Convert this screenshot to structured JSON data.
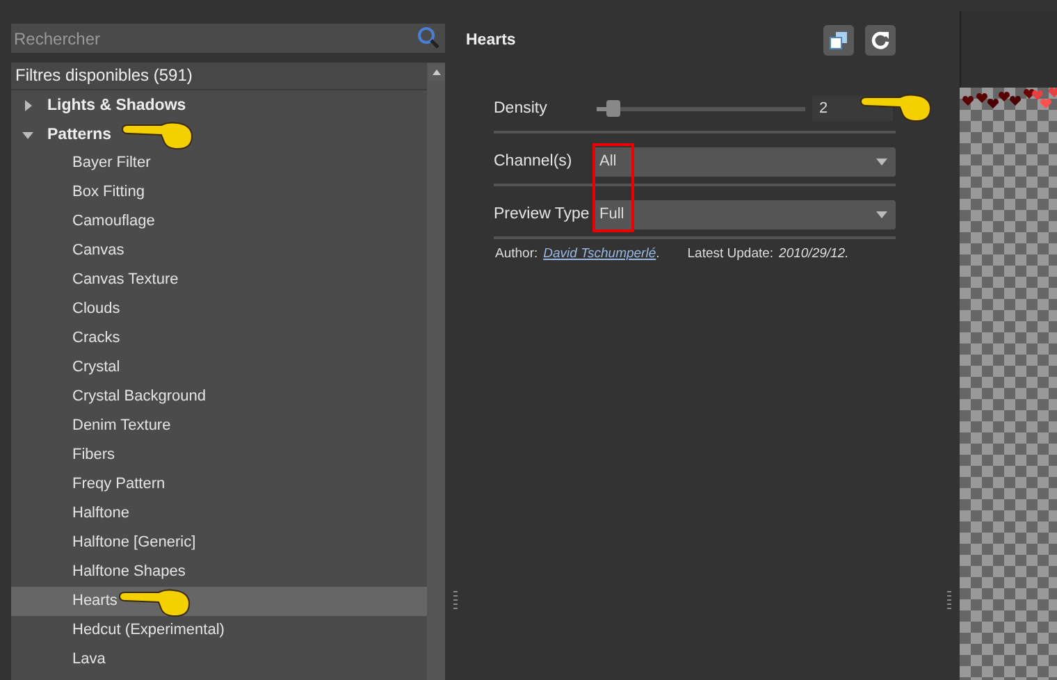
{
  "search": {
    "placeholder": "Rechercher"
  },
  "tree": {
    "header": "Filtres disponibles (591)",
    "items": [
      {
        "label": "Lights & Shadows",
        "expanded": false,
        "pointer": false
      },
      {
        "label": "Patterns",
        "expanded": true,
        "pointer": true,
        "children": [
          {
            "label": "Bayer Filter",
            "selected": false,
            "pointer": false
          },
          {
            "label": "Box Fitting",
            "selected": false,
            "pointer": false
          },
          {
            "label": "Camouflage",
            "selected": false,
            "pointer": false
          },
          {
            "label": "Canvas",
            "selected": false,
            "pointer": false
          },
          {
            "label": "Canvas Texture",
            "selected": false,
            "pointer": false
          },
          {
            "label": "Clouds",
            "selected": false,
            "pointer": false
          },
          {
            "label": "Cracks",
            "selected": false,
            "pointer": false
          },
          {
            "label": "Crystal",
            "selected": false,
            "pointer": false
          },
          {
            "label": "Crystal Background",
            "selected": false,
            "pointer": false
          },
          {
            "label": "Denim Texture",
            "selected": false,
            "pointer": false
          },
          {
            "label": "Fibers",
            "selected": false,
            "pointer": false
          },
          {
            "label": "Freqy Pattern",
            "selected": false,
            "pointer": false
          },
          {
            "label": "Halftone",
            "selected": false,
            "pointer": false
          },
          {
            "label": "Halftone [Generic]",
            "selected": false,
            "pointer": false
          },
          {
            "label": "Halftone Shapes",
            "selected": false,
            "pointer": false
          },
          {
            "label": "Hearts",
            "selected": true,
            "pointer": true
          },
          {
            "label": "Hedcut (Experimental)",
            "selected": false,
            "pointer": false
          },
          {
            "label": "Lava",
            "selected": false,
            "pointer": false
          }
        ]
      }
    ]
  },
  "filter": {
    "title": "Hearts",
    "params": [
      {
        "kind": "slider",
        "label": "Density",
        "level": 0.08,
        "value": "2",
        "pointer": true
      },
      {
        "kind": "select",
        "label": "Channel(s)",
        "value": "All"
      },
      {
        "kind": "select",
        "label": "Preview Type",
        "value": "Full"
      }
    ],
    "author_label": "Author:",
    "author": "David Tschumperlé",
    "author_after": ".",
    "update_label": "Latest Update:",
    "update": "2010/29/12."
  }
}
